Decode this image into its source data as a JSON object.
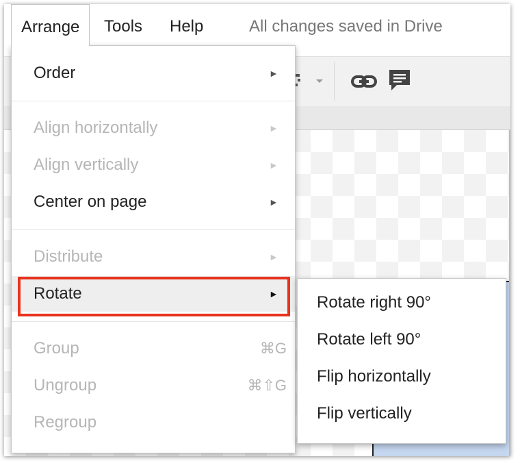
{
  "menubar": {
    "arrange": "Arrange",
    "tools": "Tools",
    "help": "Help",
    "status": "All changes saved in Drive"
  },
  "toolbar": {
    "icons": [
      "align-icon",
      "link-icon",
      "comment-icon"
    ]
  },
  "arrange_menu": {
    "order": "Order",
    "align_horizontally": "Align horizontally",
    "align_vertically": "Align vertically",
    "center_on_page": "Center on page",
    "distribute": "Distribute",
    "rotate": "Rotate",
    "group": "Group",
    "group_shortcut": "⌘G",
    "ungroup": "Ungroup",
    "ungroup_shortcut": "⌘⇧G",
    "regroup": "Regroup",
    "submenu_arrow": "►"
  },
  "rotate_submenu": {
    "rotate_right": "Rotate right 90°",
    "rotate_left": "Rotate left 90°",
    "flip_horizontally": "Flip horizontally",
    "flip_vertically": "Flip vertically"
  },
  "colors": {
    "highlight_box": "#e8321e",
    "hover": "#eeeeee",
    "disabled_text": "#b6b6b6",
    "selected_shape": "#c5d6ef"
  }
}
